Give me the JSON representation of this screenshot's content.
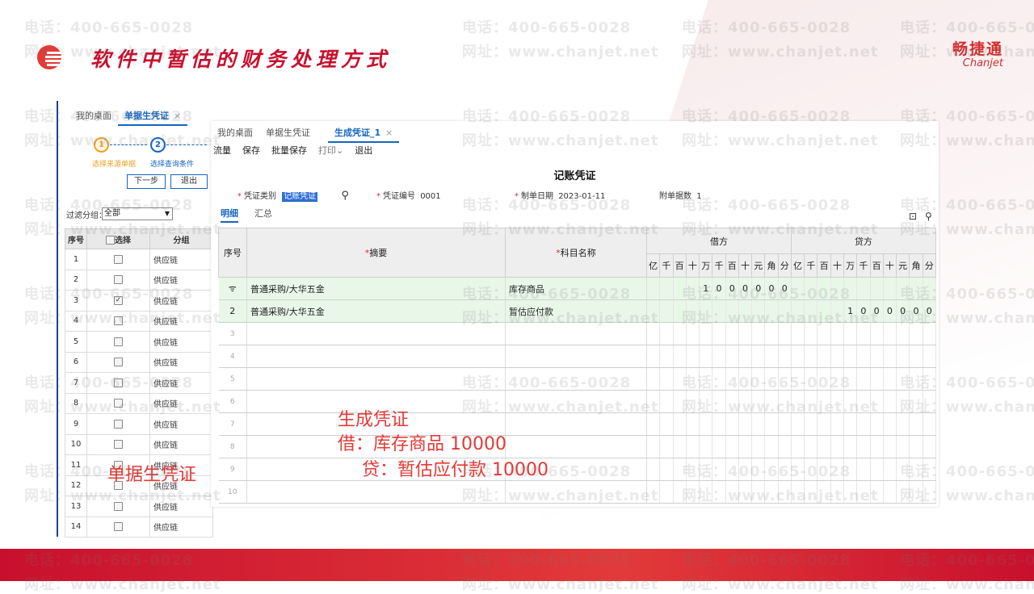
{
  "slide": {
    "title": "软件中暂估的财务处理方式",
    "brand_cn": "畅捷通",
    "brand_en": "Chanjet"
  },
  "watermark": {
    "phone": "电话：400-665-0028",
    "site": "网址：www.chanjet.net"
  },
  "back_window": {
    "tabs": [
      {
        "label": "我的桌面"
      },
      {
        "label": "单据生凭证",
        "close": "×"
      }
    ],
    "steps": [
      {
        "num": "1",
        "label": "选择来源单据"
      },
      {
        "num": "2",
        "label": "选择查询条件"
      }
    ],
    "buttons": {
      "next": "下一步",
      "exit": "退出"
    },
    "filter_label": "过滤分组：",
    "filter_value": "全部",
    "columns": {
      "seq": "序号",
      "select": "选择",
      "group": "分组"
    },
    "rows": [
      {
        "seq": "1",
        "group": "供应链",
        "checked": ""
      },
      {
        "seq": "2",
        "group": "供应链",
        "checked": ""
      },
      {
        "seq": "3",
        "group": "供应链",
        "checked": "✓"
      },
      {
        "seq": "4",
        "group": "供应链",
        "checked": ""
      },
      {
        "seq": "5",
        "group": "供应链",
        "checked": ""
      },
      {
        "seq": "6",
        "group": "供应链",
        "checked": ""
      },
      {
        "seq": "7",
        "group": "供应链",
        "checked": ""
      },
      {
        "seq": "8",
        "group": "供应链",
        "checked": ""
      },
      {
        "seq": "9",
        "group": "供应链",
        "checked": ""
      },
      {
        "seq": "10",
        "group": "供应链",
        "checked": ""
      },
      {
        "seq": "11",
        "group": "供应链",
        "checked": ""
      },
      {
        "seq": "12",
        "group": "供应链",
        "checked": ""
      },
      {
        "seq": "13",
        "group": "供应链",
        "checked": ""
      },
      {
        "seq": "14",
        "group": "供应链",
        "checked": ""
      }
    ]
  },
  "front_window": {
    "tabs": [
      {
        "label": "我的桌面"
      },
      {
        "label": "单据生凭证"
      },
      {
        "label": "生成凭证_1",
        "close": "×"
      }
    ],
    "toolbar": [
      "流量",
      "保存",
      "批量保存",
      "打印⌄",
      "退出"
    ],
    "voucher_title": "记账凭证",
    "fields": {
      "type_label": "凭证类别",
      "type_value": "记账凭证",
      "number_label": "凭证编号",
      "number_value": "0001",
      "date_label": "制单日期",
      "date_value": "2023-01-11",
      "attach_label": "附单据数",
      "attach_value": "1"
    },
    "subtabs": [
      "明细",
      "汇总"
    ],
    "grid": {
      "seq_header": "序号",
      "summary_header": "摘要",
      "account_header": "科目名称",
      "debit_header": "借方",
      "credit_header": "贷方",
      "digit_headers": [
        "亿",
        "千",
        "百",
        "十",
        "万",
        "千",
        "百",
        "十",
        "元",
        "角",
        "分"
      ],
      "rows": [
        {
          "seq": "ᯤ",
          "summary": "普通采购/大华五金",
          "account": "库存商品",
          "debit": [
            "",
            "",
            "",
            "",
            "1",
            "0",
            "0",
            "0",
            "0",
            "0",
            "0"
          ],
          "credit": [
            "",
            "",
            "",
            "",
            "",
            "",
            "",
            "",
            "",
            "",
            ""
          ]
        },
        {
          "seq": "2",
          "summary": "普通采购/大华五金",
          "account": "暂估应付款",
          "debit": [
            "",
            "",
            "",
            "",
            "",
            "",
            "",
            "",
            "",
            "",
            ""
          ],
          "credit": [
            "",
            "",
            "",
            "",
            "1",
            "0",
            "0",
            "0",
            "0",
            "0",
            "0"
          ]
        },
        {
          "seq": "3",
          "summary": "",
          "account": "",
          "debit": [],
          "credit": []
        },
        {
          "seq": "4",
          "summary": "",
          "account": "",
          "debit": [],
          "credit": []
        },
        {
          "seq": "5",
          "summary": "",
          "account": "",
          "debit": [],
          "credit": []
        },
        {
          "seq": "6",
          "summary": "",
          "account": "",
          "debit": [],
          "credit": []
        },
        {
          "seq": "7",
          "summary": "",
          "account": "",
          "debit": [],
          "credit": []
        },
        {
          "seq": "8",
          "summary": "",
          "account": "",
          "debit": [],
          "credit": []
        },
        {
          "seq": "9",
          "summary": "",
          "account": "",
          "debit": [],
          "credit": []
        },
        {
          "seq": "10",
          "summary": "",
          "account": "",
          "debit": [],
          "credit": []
        }
      ]
    }
  },
  "annotations": {
    "left": "单据生凭证",
    "line1": "生成凭证",
    "line2": "借：库存商品 10000",
    "line3": "贷：暂估应付款 10000"
  }
}
